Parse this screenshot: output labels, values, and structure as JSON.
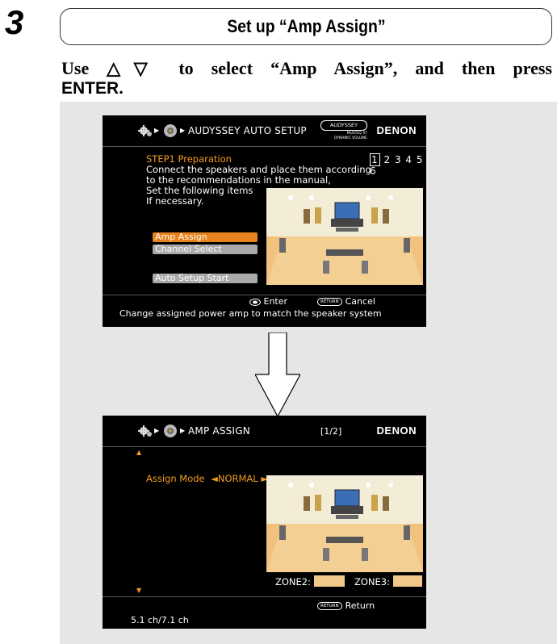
{
  "step": {
    "number": "3",
    "title": "Set up “Amp Assign”"
  },
  "instruction": {
    "line1": "Use △▽ to select “Amp Assign”, and then press",
    "line2": "ENTER."
  },
  "screen1": {
    "brand": "DENON",
    "header_title": "AUDYSSEY AUTO SETUP",
    "logo": {
      "name": "AUDYSSEY",
      "line1": "MULTEQ XT",
      "line2": "DYNAMIC VOLUME"
    },
    "step_label": "STEP1 Preparation",
    "step_numbers": [
      "1",
      "2",
      "3",
      "4",
      "5",
      "6"
    ],
    "current_step": "1",
    "body_lines": [
      "Connect the speakers and place them according",
      "to the recommendations in the manual,",
      "Set the following items",
      "If necessary."
    ],
    "menu": [
      "Amp Assign",
      "Channel Select",
      "Auto Setup Start"
    ],
    "selected_menu_item": "Amp Assign",
    "enter_label": "Enter",
    "return_badge": "RETURN",
    "cancel_label": "Cancel",
    "guide": "Change assigned power amp to match the speaker system",
    "icons": [
      "gear-icon",
      "speaker-icon",
      "enter-button-icon"
    ]
  },
  "screen2": {
    "brand": "DENON",
    "header_title": "AMP ASSIGN",
    "page_indicator": "[1/2]",
    "assign_mode_label": "Assign Mode",
    "assign_mode_value": "◄NORMAL ►",
    "zone2_label": "ZONE2:",
    "zone3_label": "ZONE3:",
    "return_badge": "RETURN",
    "return_label": "Return",
    "channel_info": "5.1 ch/7.1 ch",
    "icons": [
      "gear-icon",
      "speaker-icon",
      "scroll-up-arrow-icon",
      "scroll-down-arrow-icon"
    ]
  },
  "colors": {
    "highlight": "#f29b1f",
    "selection_bar": "#e8821c",
    "room_floor": "#f0c27e",
    "zone_box": "#f1c98a"
  }
}
